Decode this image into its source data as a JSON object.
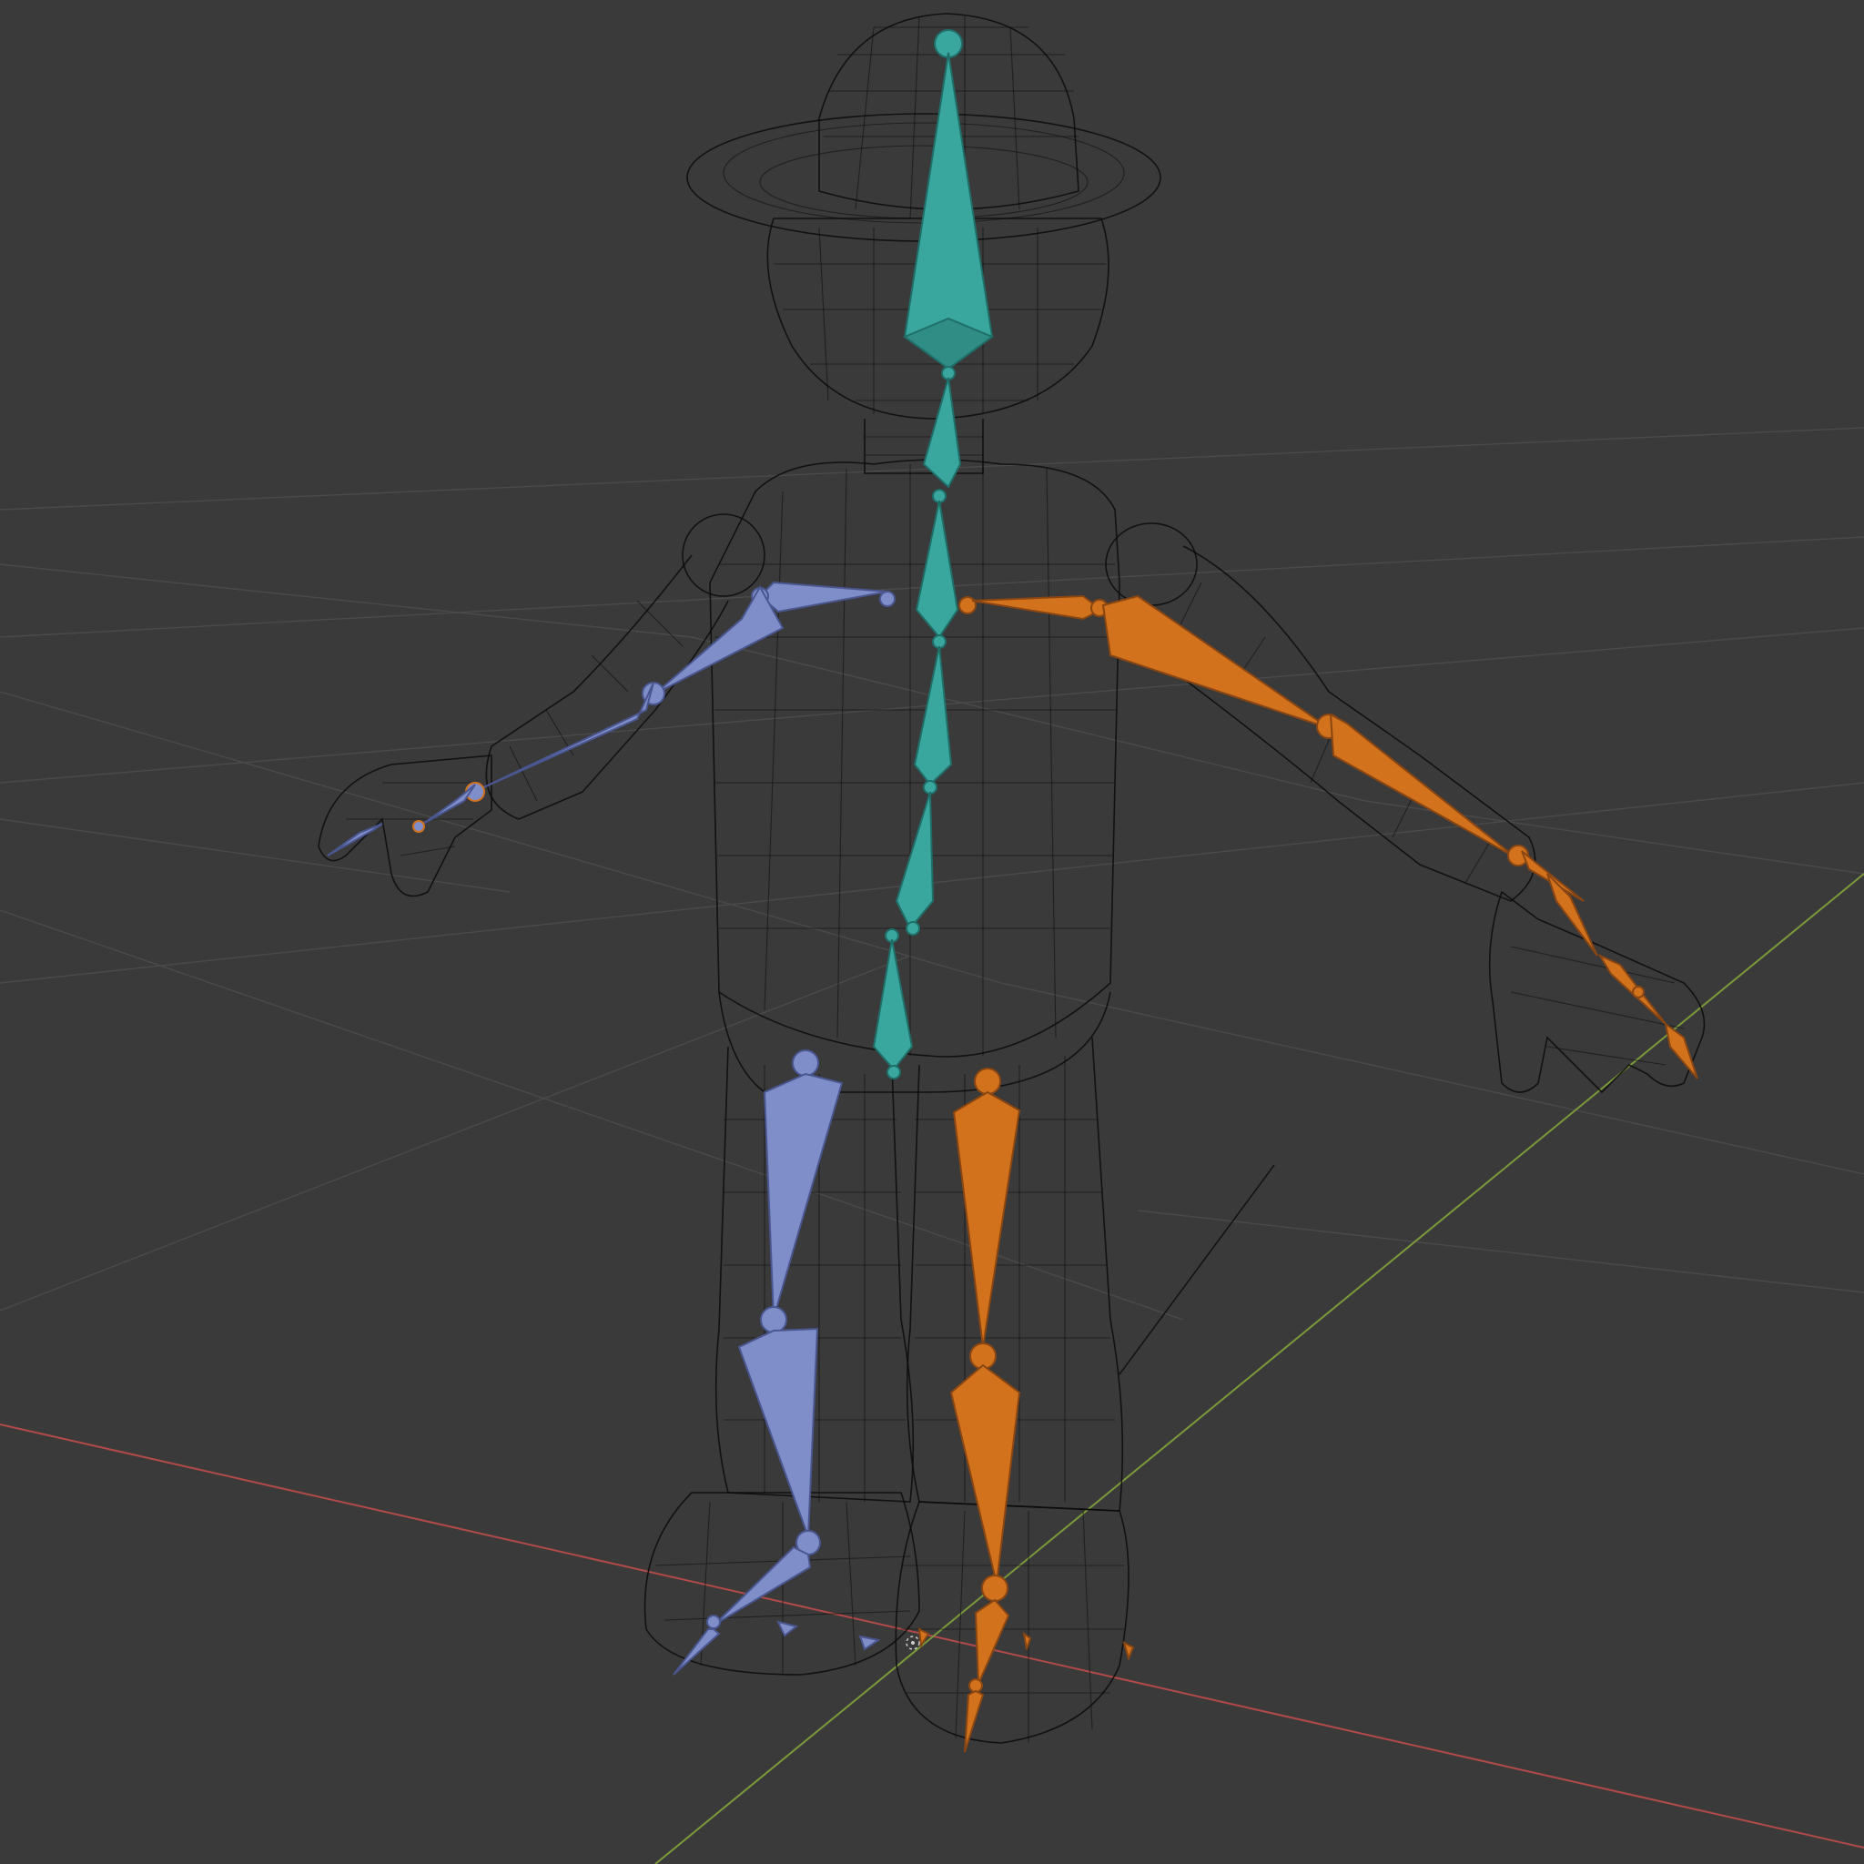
{
  "viewport": {
    "background": "#3a3a3a",
    "grid_color": "#4a4a4a",
    "axis_x_color": "#b14a48",
    "axis_y_color": "#7b9a3a"
  },
  "bone_colors": {
    "center": "#3aa79f",
    "left": "#7f8ec8",
    "right": "#d2721d"
  },
  "icons": [
    "armature-bones-icon",
    "wireframe-mesh-icon"
  ]
}
